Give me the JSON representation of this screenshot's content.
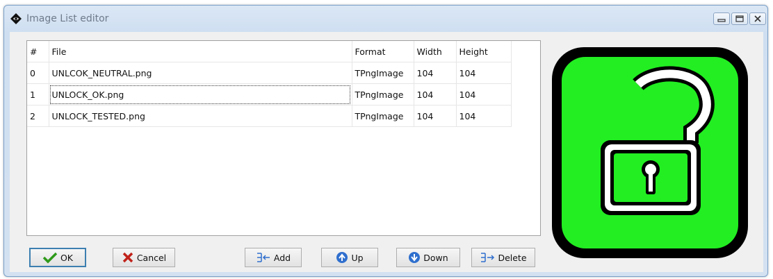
{
  "window": {
    "title": "Image List editor"
  },
  "grid": {
    "headers": [
      "#",
      "File",
      "Format",
      "Width",
      "Height"
    ],
    "rows": [
      [
        "0",
        "UNLCOK_NEUTRAL.png",
        "TPngImage",
        "104",
        "104"
      ],
      [
        "1",
        "UNLOCK_OK.png",
        "TPngImage",
        "104",
        "104"
      ],
      [
        "2",
        "UNLOCK_TESTED.png",
        "TPngImage",
        "104",
        "104"
      ]
    ]
  },
  "buttons": {
    "ok": "OK",
    "cancel": "Cancel",
    "add": "Add",
    "up": "Up",
    "down": "Down",
    "delete": "Delete"
  },
  "colors": {
    "preview_fill": "#22ee22",
    "preview_border": "#000000",
    "ok_check": "#2e9a1a",
    "cancel_x": "#c0221a",
    "arrow_blue": "#2f6fce"
  },
  "preview": {
    "icon": "unlocked-padlock-icon"
  }
}
